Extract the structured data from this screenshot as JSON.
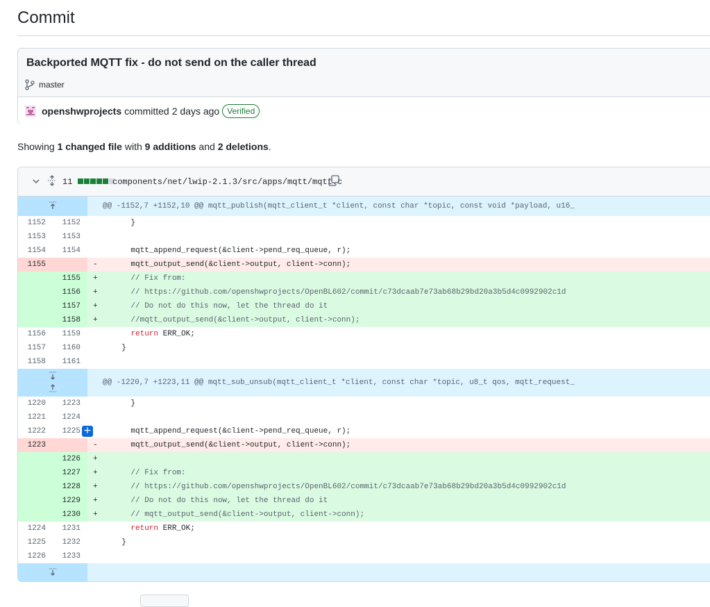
{
  "page": {
    "title": "Commit"
  },
  "commit": {
    "message": "Backported MQTT fix - do not send on the caller thread",
    "branch": "master",
    "author": "openshwprojects",
    "action": "committed",
    "time": "2 days ago",
    "verified": "Verified"
  },
  "summary": {
    "prefix": "Showing ",
    "files": "1 changed file",
    "with": " with ",
    "additions": "9 additions",
    "and": " and ",
    "deletions": "2 deletions",
    "suffix": "."
  },
  "file": {
    "change_count": "11",
    "path": "components/net/lwip-2.1.3/src/apps/mqtt/mqtt.c",
    "bar_colors": [
      "#1a7f37",
      "#1a7f37",
      "#1a7f37",
      "#1a7f37",
      "#1a7f37",
      "#d1d9e0"
    ]
  },
  "hunks": [
    {
      "header": "@@ -1152,7 +1152,10 @@ mqtt_publish(mqtt_client_t *client, const char *topic, const void *payload, u16_"
    },
    {
      "header": "@@ -1220,7 +1223,11 @@ mqtt_sub_unsub(mqtt_client_t *client, const char *topic, u8_t qos, mqtt_request_"
    }
  ],
  "lines": [
    {
      "old": "1152",
      "new": "1152",
      "sign": "",
      "code": "    }"
    },
    {
      "old": "1153",
      "new": "1153",
      "sign": "",
      "code": ""
    },
    {
      "old": "1154",
      "new": "1154",
      "sign": "",
      "code": "    mqtt_append_request(&client->pend_req_queue, r);"
    },
    {
      "old": "1155",
      "new": "",
      "sign": "-",
      "code": "    mqtt_output_send(&client->output, client->conn);"
    },
    {
      "old": "",
      "new": "1155",
      "sign": "+",
      "code": "    // Fix from:"
    },
    {
      "old": "",
      "new": "1156",
      "sign": "+",
      "code": "    // https://github.com/openshwprojects/OpenBL602/commit/c73dcaab7e73ab68b29bd20a3b5d4c0992902c1d"
    },
    {
      "old": "",
      "new": "1157",
      "sign": "+",
      "code": "    // Do not do this now, let the thread do it"
    },
    {
      "old": "",
      "new": "1158",
      "sign": "+",
      "code": "    //mqtt_output_send(&client->output, client->conn);"
    },
    {
      "old": "1156",
      "new": "1159",
      "sign": "",
      "code": "    return ERR_OK;"
    },
    {
      "old": "1157",
      "new": "1160",
      "sign": "",
      "code": "  }"
    },
    {
      "old": "1158",
      "new": "1161",
      "sign": "",
      "code": ""
    },
    {
      "old": "1220",
      "new": "1223",
      "sign": "",
      "code": "    }"
    },
    {
      "old": "1221",
      "new": "1224",
      "sign": "",
      "code": ""
    },
    {
      "old": "1222",
      "new": "1225",
      "sign": "",
      "code": "    mqtt_append_request(&client->pend_req_queue, r);"
    },
    {
      "old": "1223",
      "new": "",
      "sign": "-",
      "code": "    mqtt_output_send(&client->output, client->conn);"
    },
    {
      "old": "",
      "new": "1226",
      "sign": "+",
      "code": ""
    },
    {
      "old": "",
      "new": "1227",
      "sign": "+",
      "code": "    // Fix from:"
    },
    {
      "old": "",
      "new": "1228",
      "sign": "+",
      "code": "    // https://github.com/openshwprojects/OpenBL602/commit/c73dcaab7e73ab68b29bd20a3b5d4c0992902c1d"
    },
    {
      "old": "",
      "new": "1229",
      "sign": "+",
      "code": "    // Do not do this now, let the thread do it"
    },
    {
      "old": "",
      "new": "1230",
      "sign": "+",
      "code": "    // mqtt_output_send(&client->output, client->conn);"
    },
    {
      "old": "1224",
      "new": "1231",
      "sign": "",
      "code": "    return ERR_OK;"
    },
    {
      "old": "1225",
      "new": "1232",
      "sign": "",
      "code": "  }"
    },
    {
      "old": "1226",
      "new": "1233",
      "sign": "",
      "code": ""
    }
  ],
  "add_comment_symbol": "+"
}
